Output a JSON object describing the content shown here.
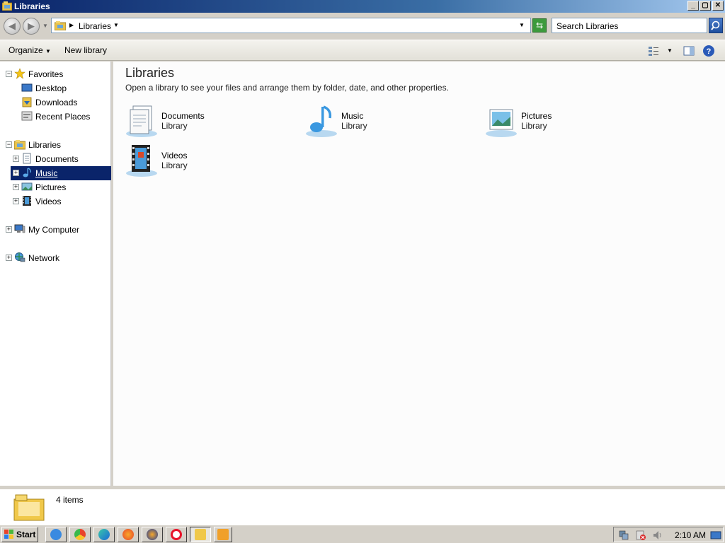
{
  "window": {
    "title": "Libraries",
    "buttons": {
      "minimize": "_",
      "maximize": "▢",
      "close": "✕"
    }
  },
  "address": {
    "crumb": "Libraries",
    "search_placeholder": "Search Libraries"
  },
  "toolbar": {
    "organize_label": "Organize",
    "new_library_label": "New library"
  },
  "nav": {
    "favorites": {
      "label": "Favorites",
      "items": [
        "Desktop",
        "Downloads",
        "Recent Places"
      ]
    },
    "libraries": {
      "label": "Libraries",
      "items": [
        "Documents",
        "Music",
        "Pictures",
        "Videos"
      ],
      "selected": "Music"
    },
    "computer": "My Computer",
    "network": "Network"
  },
  "main": {
    "title": "Libraries",
    "subtitle": "Open a library to see your files and arrange them by folder, date, and other properties.",
    "libraries": [
      {
        "name": "Documents",
        "kind": "Library",
        "icon": "documents-icon"
      },
      {
        "name": "Music",
        "kind": "Library",
        "icon": "music-icon"
      },
      {
        "name": "Pictures",
        "kind": "Library",
        "icon": "pictures-icon"
      },
      {
        "name": "Videos",
        "kind": "Library",
        "icon": "videos-icon"
      }
    ]
  },
  "details": {
    "count_text": "4 items"
  },
  "taskbar": {
    "start_label": "Start",
    "clock": "2:10 AM",
    "apps": [
      "ie-icon",
      "chrome-icon",
      "edge-icon",
      "firefox-icon",
      "firefox-dev-icon",
      "opera-icon",
      "explorer-icon",
      "media-player-icon"
    ]
  },
  "colors": {
    "selection": "#0a246a",
    "title_start": "#0a246a",
    "title_end": "#a6caf0"
  }
}
